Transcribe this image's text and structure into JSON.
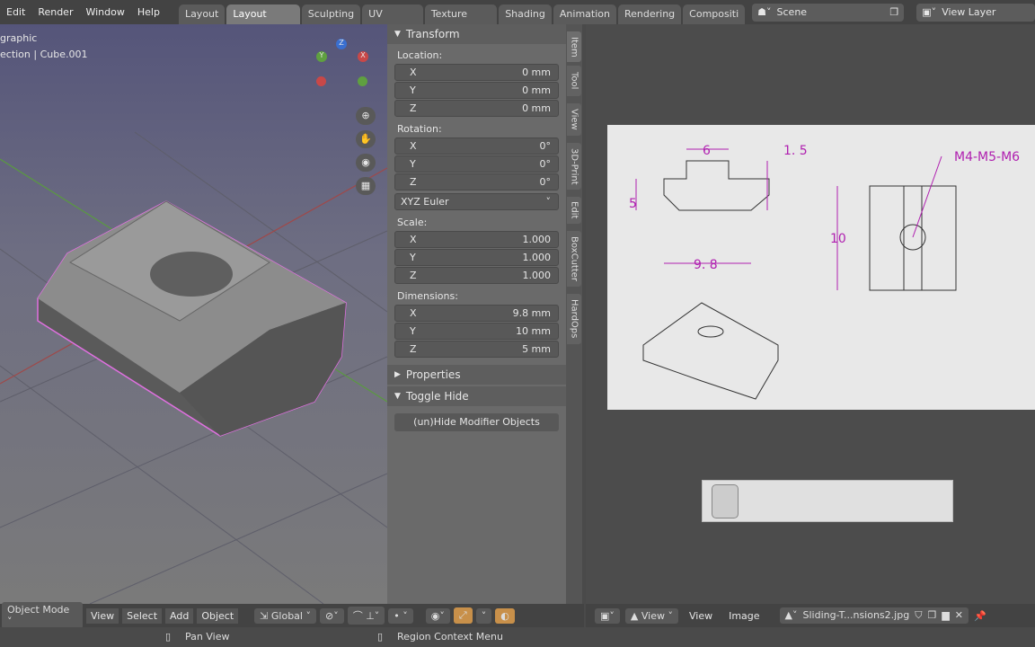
{
  "topbar": {
    "menus": [
      "Edit",
      "Render",
      "Window",
      "Help"
    ],
    "workspaces": [
      "Layout",
      "Layout Ortho",
      "Sculpting",
      "UV Editing",
      "Texture Paint",
      "Shading",
      "Animation",
      "Rendering",
      "Compositi"
    ],
    "active_workspace": "Layout Ortho",
    "scene": "Scene",
    "view_layer": "View Layer"
  },
  "viewport": {
    "view_name": "graphic",
    "collection": "ection | Cube.001",
    "gizmo": {
      "x": "X",
      "y": "Y",
      "z": "Z"
    }
  },
  "npanel": {
    "transform_title": "Transform",
    "location_label": "Location:",
    "location": [
      {
        "axis": "X",
        "value": "0 mm"
      },
      {
        "axis": "Y",
        "value": "0 mm"
      },
      {
        "axis": "Z",
        "value": "0 mm"
      }
    ],
    "rotation_label": "Rotation:",
    "rotation": [
      {
        "axis": "X",
        "value": "0°"
      },
      {
        "axis": "Y",
        "value": "0°"
      },
      {
        "axis": "Z",
        "value": "0°"
      }
    ],
    "rotation_mode": "XYZ Euler",
    "scale_label": "Scale:",
    "scale": [
      {
        "axis": "X",
        "value": "1.000"
      },
      {
        "axis": "Y",
        "value": "1.000"
      },
      {
        "axis": "Z",
        "value": "1.000"
      }
    ],
    "dimensions_label": "Dimensions:",
    "dimensions": [
      {
        "axis": "X",
        "value": "9.8 mm"
      },
      {
        "axis": "Y",
        "value": "10 mm"
      },
      {
        "axis": "Z",
        "value": "5 mm"
      }
    ],
    "properties_title": "Properties",
    "toggle_hide_title": "Toggle Hide",
    "hide_button": "(un)Hide Modifier Objects"
  },
  "side_tabs": [
    "Item",
    "Tool",
    "View",
    "3D-Print",
    "Edit",
    "BoxCutter",
    "HardOps"
  ],
  "drawing": {
    "dim_top": "6",
    "dim_small": "1. 5",
    "thread": "M4-M5-M6",
    "dim_height": "5",
    "dim_width": "9. 8",
    "dim_length": "10"
  },
  "header3d": {
    "mode": "Object Mode",
    "menus": [
      "View",
      "Select",
      "Add",
      "Object"
    ],
    "orientation": "Global"
  },
  "header_img": {
    "view_menu": "View",
    "menus": [
      "View",
      "Image"
    ],
    "image_name": "Sliding-T...nsions2.jpg"
  },
  "status": {
    "left": "Pan View",
    "middle": "Region Context Menu"
  }
}
